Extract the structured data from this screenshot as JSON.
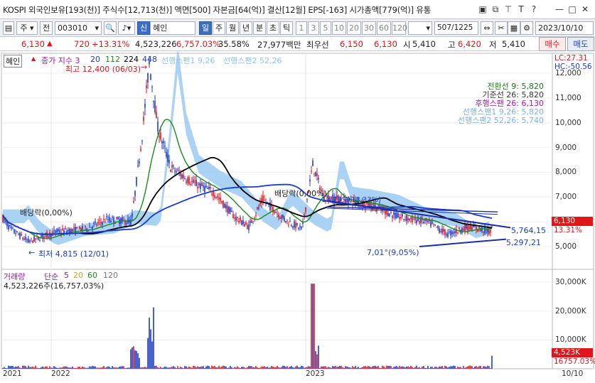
{
  "window": {
    "title": "KOSPI 외국인보유[193(천)] 주식수[12,713(천)] 액면[500] 자본금[64(억)] 결산[12월] EPS[-163] 시가총액[779(억)] 유통",
    "icons": [
      "window-restore-icon",
      "copy-icon",
      "pin-icon",
      "text-icon",
      "help-icon",
      "minimize-icon",
      "maximize-icon",
      "close-icon"
    ]
  },
  "toolbar": {
    "period_select": "주",
    "prev_label": "전",
    "code": "003010",
    "new_badge": "신",
    "stock_name": "혜인",
    "period_buttons": [
      "일",
      "주",
      "월",
      "년",
      "분",
      "초",
      "틱"
    ],
    "active_period": "일",
    "interval_buttons": [
      "1",
      "3",
      "5",
      "10",
      "20",
      "30",
      "60",
      "120"
    ],
    "count": "507",
    "total": "/1225",
    "date": "2023/10/10"
  },
  "quote": {
    "price": "6,130",
    "change": "720",
    "change_pct": "+13.31%",
    "volume": "4,523,226",
    "volume_pct": "6,757.03%",
    "turnover": "35.58%",
    "amount": "27,977백만",
    "best_label": "최우선",
    "ask": "6,150",
    "bid": "6,130",
    "open_label": "시",
    "open": "5,410",
    "high_label": "고",
    "high": "6,420",
    "low_label": "저",
    "low": "5,410",
    "buy_label": "매수",
    "sell_label": "매도"
  },
  "price_panel": {
    "stock_tag": "혜인",
    "legend_title": "종가 지수 3",
    "ma_periods": [
      "20",
      "112",
      "224",
      "448"
    ],
    "span_labels": [
      "선행스팬1 9,26",
      "선행스팬2 52,26"
    ],
    "max_label": "최고 12,400 (06/03)",
    "min_label": "최저 4,815 (12/01)",
    "dividend_label_1": "배당락(0,00%)",
    "dividend_label_2": "배당락(0,00%)",
    "mid_label": "13,73%(13.33%)",
    "trend_upper_value": "5,764,15",
    "trend_lower_value": "5,297,21",
    "trend_pct": "7,01°(9,05%)",
    "ichimoku": [
      {
        "label": "전환선 9: 5,820",
        "color": "#1c7a1c"
      },
      {
        "label": "기준선 26: 5,820",
        "color": "#333333"
      },
      {
        "label": "후행스팬 26: 6,130",
        "color": "#9b1aa8"
      },
      {
        "label": "선행스팬1 9,26: 5,820",
        "color": "#7fb1e6"
      },
      {
        "label": "선행스팬2 52,26: 5,740",
        "color": "#7fb1e6"
      }
    ],
    "lc_label": "LC:27.31",
    "hc_label": "HC:-50.56",
    "y_ticks": [
      "12,000",
      "11,000",
      "10,000",
      "9,000",
      "8,000",
      "7,000",
      "6,000",
      "5,000"
    ],
    "price_tag": "6,130",
    "price_pct_tag": "13.31%"
  },
  "volume_panel": {
    "legend_title": "거래량",
    "ma_label": "단순",
    "ma_periods": [
      "5",
      "20",
      "60",
      "120"
    ],
    "current": "4,523,226주(16,757,03%)",
    "y_ticks": [
      "30,000K",
      "20,000K",
      "10,000K"
    ],
    "vol_tag": "4,523K",
    "vol_pct_tag": "16757.03%"
  },
  "x_axis": {
    "labels": [
      "2021",
      "2022",
      "2023"
    ],
    "right_date": "10/10"
  },
  "colors": {
    "up": "#e0161b",
    "down": "#1b3cc8",
    "cloud": "#8ec3f0",
    "ma20": "#1b8a1b",
    "ma112": "#000000",
    "ma224": "#1b3cc8",
    "accent": "#3a6fc4"
  }
}
